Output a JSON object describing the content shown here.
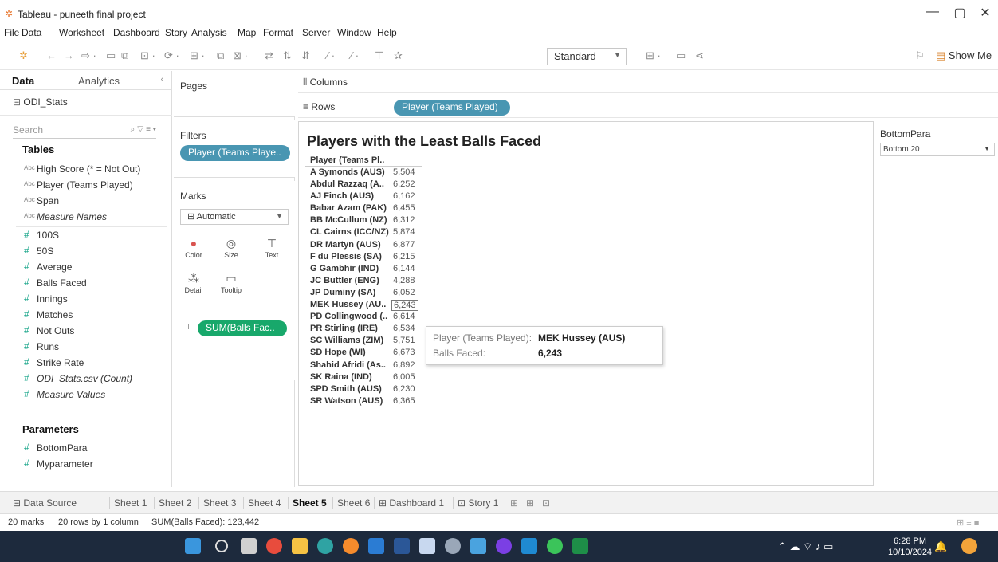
{
  "window": {
    "title": "Tableau - puneeth final project",
    "app_icon": "tableau-icon",
    "minimize": "—",
    "restore": "▢",
    "close": "✕"
  },
  "menu": [
    "File",
    "Data",
    "Worksheet",
    "Dashboard",
    "Story",
    "Analysis",
    "Map",
    "Format",
    "Server",
    "Window",
    "Help"
  ],
  "toolbar": {
    "fit_value": "Standard",
    "show_me_label": "Show Me"
  },
  "left_pane": {
    "tab_data": "Data",
    "tab_analytics": "Analytics",
    "data_source": "ODI_Stats",
    "search_placeholder": "Search",
    "tables_header": "Tables",
    "dimensions": [
      {
        "label": "High Score (* = Not Out)",
        "italic": false
      },
      {
        "label": "Player (Teams Played)",
        "italic": false
      },
      {
        "label": "Span",
        "italic": false
      },
      {
        "label": "Measure Names",
        "italic": true
      }
    ],
    "measures": [
      {
        "label": "100S",
        "italic": false
      },
      {
        "label": "50S",
        "italic": false
      },
      {
        "label": "Average",
        "italic": false
      },
      {
        "label": "Balls Faced",
        "italic": false
      },
      {
        "label": "Innings",
        "italic": false
      },
      {
        "label": "Matches",
        "italic": false
      },
      {
        "label": "Not Outs",
        "italic": false
      },
      {
        "label": "Runs",
        "italic": false
      },
      {
        "label": "Strike Rate",
        "italic": false
      },
      {
        "label": "ODI_Stats.csv (Count)",
        "italic": true
      },
      {
        "label": "Measure Values",
        "italic": true
      }
    ],
    "parameters_header": "Parameters",
    "parameters": [
      "BottomPara",
      "Myparameter"
    ],
    "dim_type_label": "Abc"
  },
  "shelves": {
    "pages_label": "Pages",
    "filters_label": "Filters",
    "filter_pill": "Player (Teams Playe..",
    "marks_label": "Marks",
    "mark_type": "Automatic",
    "mark_buttons": {
      "color": "Color",
      "size": "Size",
      "text": "Text",
      "detail": "Detail",
      "tooltip": "Tooltip"
    },
    "text_pill": "SUM(Balls Fac..",
    "columns_label": "Columns",
    "rows_label": "Rows",
    "rows_pill": "Player (Teams Played)"
  },
  "view": {
    "title": "Players with the Least Balls Faced",
    "column_header": "Player (Teams Pl..",
    "rows": [
      {
        "name": "A Symonds (AUS)",
        "value": "5,504"
      },
      {
        "name": "Abdul Razzaq (A..",
        "value": "6,252"
      },
      {
        "name": "AJ Finch (AUS)",
        "value": "6,162"
      },
      {
        "name": "Babar Azam (PAK)",
        "value": "6,455"
      },
      {
        "name": "BB McCullum (NZ)",
        "value": "6,312"
      },
      {
        "name": "CL Cairns (ICC/NZ)",
        "value": "5,874"
      },
      {
        "name": "DR Martyn (AUS)",
        "value": "6,877"
      },
      {
        "name": "F du Plessis (SA)",
        "value": "6,215"
      },
      {
        "name": "G Gambhir (IND)",
        "value": "6,144"
      },
      {
        "name": "JC Buttler (ENG)",
        "value": "4,288"
      },
      {
        "name": "JP Duminy (SA)",
        "value": "6,052"
      },
      {
        "name": "MEK Hussey (AU..",
        "value": "6,243"
      },
      {
        "name": "PD Collingwood (..",
        "value": "6,614"
      },
      {
        "name": "PR Stirling (IRE)",
        "value": "6,534"
      },
      {
        "name": "SC Williams (ZIM)",
        "value": "5,751"
      },
      {
        "name": "SD Hope (WI)",
        "value": "6,673"
      },
      {
        "name": "Shahid Afridi (As..",
        "value": "6,892"
      },
      {
        "name": "SK Raina (IND)",
        "value": "6,005"
      },
      {
        "name": "SPD Smith (AUS)",
        "value": "6,230"
      },
      {
        "name": "SR Watson (AUS)",
        "value": "6,365"
      }
    ],
    "selected_row_index": 11
  },
  "tooltip": {
    "label1": "Player (Teams Played):",
    "value1": "MEK Hussey (AUS)",
    "label2": "Balls Faced:",
    "value2": "6,243"
  },
  "parameter_card": {
    "title": "BottomPara",
    "value": "Bottom 20"
  },
  "sheet_tabs": [
    "Data Source",
    "Sheet 1",
    "Sheet 2",
    "Sheet 3",
    "Sheet 4",
    "Sheet 5",
    "Sheet 6",
    "Dashboard 1",
    "Story 1"
  ],
  "active_sheet": "Sheet 5",
  "status": {
    "marks": "20 marks",
    "rows": "20 rows by 1 column",
    "sum": "SUM(Balls Faced): 123,442"
  },
  "clock": {
    "time": "6:28 PM",
    "date": "10/10/2024"
  },
  "colors": {
    "pill_blue": "#4996b2",
    "pill_green": "#18a86b",
    "taskbar": "#1d2a3d"
  }
}
